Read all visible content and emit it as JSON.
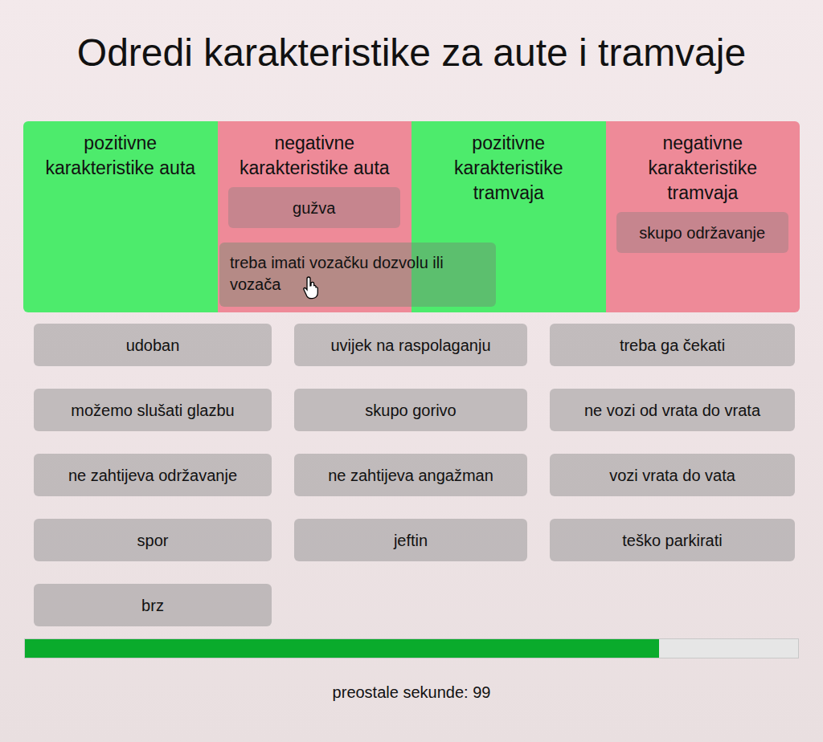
{
  "title": "Odredi karakteristike za aute i tramvaje",
  "categories": [
    {
      "label": "pozitivne karakteristike auta",
      "color": "#4deb6c",
      "items": []
    },
    {
      "label": "negativne karakteristike auta",
      "color": "#ee8a98",
      "items": [
        "gužva"
      ]
    },
    {
      "label": "pozitivne karakteristike tramvaja",
      "color": "#4deb6c",
      "items": []
    },
    {
      "label": "negativne karakteristike tramvaja",
      "color": "#ee8a98",
      "items": [
        "skupo održavanje"
      ]
    }
  ],
  "dragged": {
    "text": "treba imati vozačku dozvolu ili vozača"
  },
  "pool": [
    "udoban",
    "uvijek na raspolaganju",
    "treba ga čekati",
    "možemo slušati glazbu",
    "skupo gorivo",
    "ne vozi od vrata do vrata",
    "ne zahtijeva održavanje",
    "ne zahtijeva angažman",
    "vozi vrata do vata",
    "spor",
    "jeftin",
    "teško parkirati",
    "brz"
  ],
  "progress": {
    "level": 0.82
  },
  "timer": "preostale sekunde: 99"
}
